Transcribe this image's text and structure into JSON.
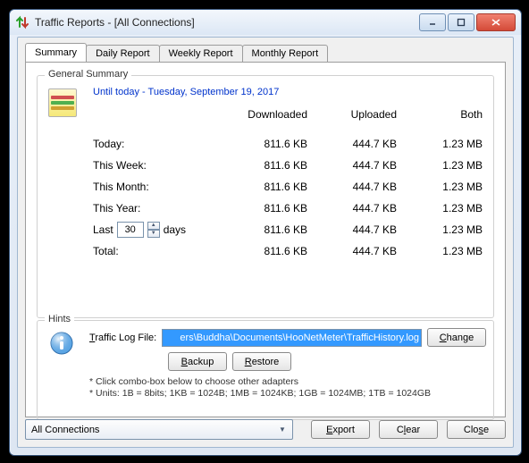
{
  "window": {
    "title": "Traffic Reports - [All Connections]"
  },
  "tabs": [
    {
      "label": "Summary",
      "active": true
    },
    {
      "label": "Daily Report",
      "active": false
    },
    {
      "label": "Weekly Report",
      "active": false
    },
    {
      "label": "Monthly Report",
      "active": false
    }
  ],
  "summary": {
    "legend": "General Summary",
    "date_line": "Until today - Tuesday, September 19, 2017",
    "headers": {
      "downloaded": "Downloaded",
      "uploaded": "Uploaded",
      "both": "Both"
    },
    "rows": [
      {
        "label": "Today:",
        "d": "811.6 KB",
        "u": "444.7 KB",
        "b": "1.23 MB"
      },
      {
        "label": "This Week:",
        "d": "811.6 KB",
        "u": "444.7 KB",
        "b": "1.23 MB"
      },
      {
        "label": "This Month:",
        "d": "811.6 KB",
        "u": "444.7 KB",
        "b": "1.23 MB"
      },
      {
        "label": "This Year:",
        "d": "811.6 KB",
        "u": "444.7 KB",
        "b": "1.23 MB"
      }
    ],
    "last": {
      "prefix": "Last",
      "value": "30",
      "suffix": "days",
      "d": "811.6 KB",
      "u": "444.7 KB",
      "b": "1.23 MB"
    },
    "total": {
      "label": "Total:",
      "d": "811.6 KB",
      "u": "444.7 KB",
      "b": "1.23 MB"
    }
  },
  "hints": {
    "legend": "Hints",
    "log_label_pre": "T",
    "log_label_rest": "raffic Log File:",
    "log_path": "ers\\Buddha\\Documents\\HooNetMeter\\TrafficHistory.log",
    "change_u": "C",
    "change_rest": "hange",
    "backup_u": "B",
    "backup_rest": "ackup",
    "restore_u": "R",
    "restore_rest": "estore",
    "note1": "* Click combo-box below to choose other adapters",
    "note2": "* Units: 1B = 8bits; 1KB = 1024B; 1MB = 1024KB; 1GB = 1024MB; 1TB = 1024GB"
  },
  "bottom": {
    "combo_value": "All Connections",
    "export_u": "E",
    "export_rest": "xport",
    "clear_u": "l",
    "clear_pre": "C",
    "clear_rest": "ear",
    "close_u": "s",
    "close_pre": "Clo",
    "close_rest": "e"
  }
}
